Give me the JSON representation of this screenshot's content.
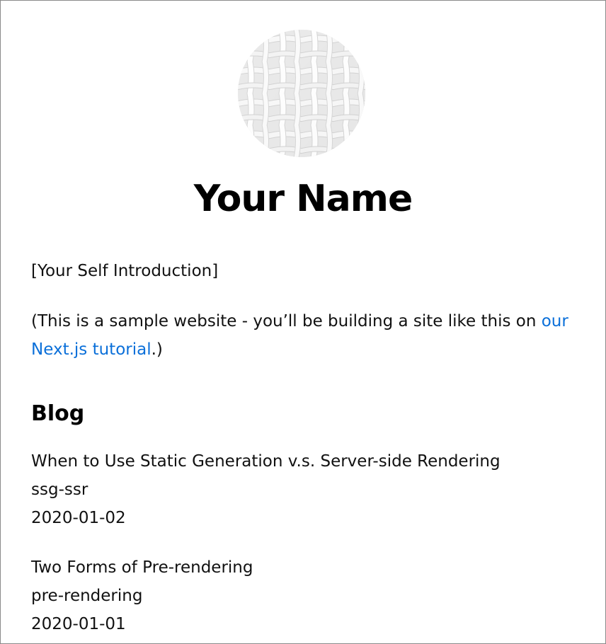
{
  "profile": {
    "avatar_icon": "woven-pattern-avatar",
    "name": "Your Name"
  },
  "intro": {
    "self_introduction": "[Your Self Introduction]",
    "sample_prefix": "(This is a sample website - you’ll be building a site like this on ",
    "tutorial_link_text": "our Next.js tutorial",
    "sample_suffix": ".)"
  },
  "blog": {
    "heading": "Blog",
    "posts": [
      {
        "title": "When to Use Static Generation v.s. Server-side Rendering",
        "id": "ssg-ssr",
        "date": "2020-01-02"
      },
      {
        "title": "Two Forms of Pre-rendering",
        "id": "pre-rendering",
        "date": "2020-01-01"
      }
    ]
  },
  "colors": {
    "link": "#0a6fd9",
    "text": "#111111",
    "border": "#8a8a8a"
  }
}
